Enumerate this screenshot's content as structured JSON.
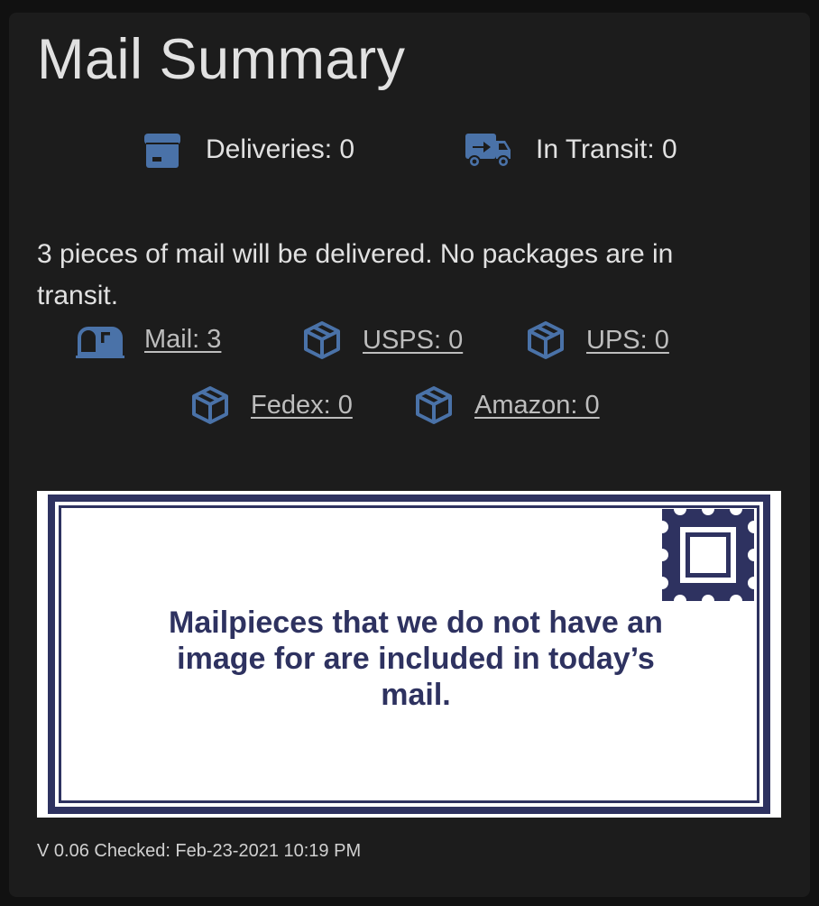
{
  "card": {
    "title": "Mail Summary"
  },
  "stats": {
    "deliveries": "Deliveries: 0",
    "in_transit": "In Transit: 0"
  },
  "summary_text": "3 pieces of mail will be delivered. No packages are in transit.",
  "carriers": {
    "mail": "Mail: 3",
    "usps": "USPS: 0",
    "ups": "UPS: 0",
    "fedex": "Fedex: 0",
    "amazon": "Amazon: 0"
  },
  "mail_image": {
    "message": "Mailpieces that we do not have an image for are included in today’s mail."
  },
  "footer": {
    "version_checked": "V 0.06 Checked: Feb-23-2021 10:19 PM"
  },
  "icons": {
    "deliveries": "package-box-icon",
    "in_transit": "truck-fast-icon",
    "mail": "mailbox-icon",
    "carrier": "package-variant-icon"
  },
  "colors": {
    "icon_blue": "#4a72a8",
    "card_bg": "#1c1c1c",
    "stamp_navy": "#2e3260",
    "text": "#e1e1e1",
    "link": "#bdbdbd"
  }
}
